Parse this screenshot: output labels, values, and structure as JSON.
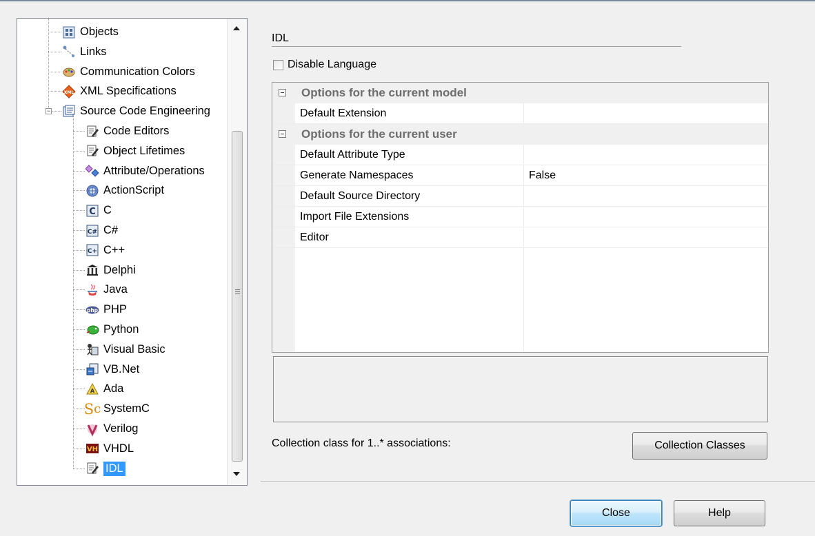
{
  "tree": {
    "items": [
      {
        "label": "Objects",
        "icon": "objects-icon",
        "level": 0
      },
      {
        "label": "Links",
        "icon": "links-icon",
        "level": 0
      },
      {
        "label": "Communication Colors",
        "icon": "communication-colors-icon",
        "level": 0
      },
      {
        "label": "XML Specifications",
        "icon": "xml-icon",
        "level": 0
      },
      {
        "label": "Source Code Engineering",
        "icon": "source-code-icon",
        "level": 0,
        "expanded": true
      },
      {
        "label": "Code Editors",
        "icon": "code-editor-icon",
        "level": 1
      },
      {
        "label": "Object Lifetimes",
        "icon": "object-lifetimes-icon",
        "level": 1
      },
      {
        "label": "Attribute/Operations",
        "icon": "attribute-operations-icon",
        "level": 1
      },
      {
        "label": "ActionScript",
        "icon": "actionscript-icon",
        "level": 1
      },
      {
        "label": "C",
        "icon": "c-icon",
        "level": 1
      },
      {
        "label": "C#",
        "icon": "csharp-icon",
        "level": 1
      },
      {
        "label": "C++",
        "icon": "cpp-icon",
        "level": 1
      },
      {
        "label": "Delphi",
        "icon": "delphi-icon",
        "level": 1
      },
      {
        "label": "Java",
        "icon": "java-icon",
        "level": 1
      },
      {
        "label": "PHP",
        "icon": "php-icon",
        "level": 1
      },
      {
        "label": "Python",
        "icon": "python-icon",
        "level": 1
      },
      {
        "label": "Visual Basic",
        "icon": "visual-basic-icon",
        "level": 1
      },
      {
        "label": "VB.Net",
        "icon": "vbnet-icon",
        "level": 1
      },
      {
        "label": "Ada",
        "icon": "ada-icon",
        "level": 1
      },
      {
        "label": "SystemC",
        "icon": "systemc-icon",
        "level": 1
      },
      {
        "label": "Verilog",
        "icon": "verilog-icon",
        "level": 1
      },
      {
        "label": "VHDL",
        "icon": "vhdl-icon",
        "level": 1
      },
      {
        "label": "IDL",
        "icon": "idl-icon",
        "level": 1,
        "selected": true
      }
    ]
  },
  "page": {
    "title": "IDL",
    "disable_language_label": "Disable Language",
    "disable_language_checked": false
  },
  "grid": {
    "rows": [
      {
        "type": "category",
        "label": "Options for the current model"
      },
      {
        "type": "property",
        "name": "Default Extension",
        "value": ""
      },
      {
        "type": "category",
        "label": "Options for the current user"
      },
      {
        "type": "property",
        "name": "Default Attribute Type",
        "value": ""
      },
      {
        "type": "property",
        "name": "Generate Namespaces",
        "value": "False"
      },
      {
        "type": "property",
        "name": "Default Source Directory",
        "value": ""
      },
      {
        "type": "property",
        "name": "Import File Extensions",
        "value": ""
      },
      {
        "type": "property",
        "name": "Editor",
        "value": ""
      }
    ]
  },
  "collection": {
    "label": "Collection class for 1..* associations:",
    "button_label": "Collection Classes"
  },
  "footer": {
    "close_label": "Close",
    "help_label": "Help"
  },
  "colors": {
    "selection": "#3399ff",
    "category_text": "#6d6d6d",
    "window_bg": "#f0f0f0"
  }
}
